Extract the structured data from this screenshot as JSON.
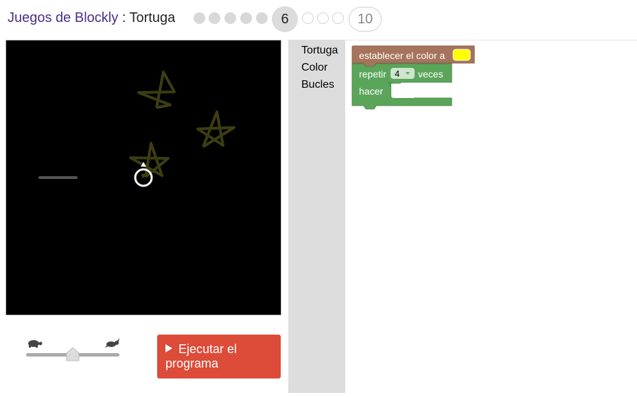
{
  "header": {
    "app_name": "Juegos de Blockly",
    "separator": " : ",
    "game_name": "Tortuga",
    "levels": {
      "done": 5,
      "current": "6",
      "open": 3,
      "last": "10"
    }
  },
  "canvas": {
    "background": "#000000",
    "ink_color": "#3d3d12"
  },
  "controls": {
    "speed_slider": {
      "value": 0.5,
      "slow_icon": "turtle-icon",
      "fast_icon": "rabbit-icon"
    },
    "run_button_label": "Ejecutar el programa"
  },
  "toolbox": {
    "categories": [
      "Tortuga",
      "Color",
      "Bucles"
    ]
  },
  "workspace": {
    "blocks": {
      "set_colour": {
        "label": "establecer el color a",
        "colour_value": "#ffff00",
        "block_color": "#a5745b"
      },
      "repeat": {
        "label_repeat": "repetir",
        "count": "4",
        "label_times": "veces",
        "label_do": "hacer",
        "block_color": "#5ba55b"
      }
    }
  }
}
